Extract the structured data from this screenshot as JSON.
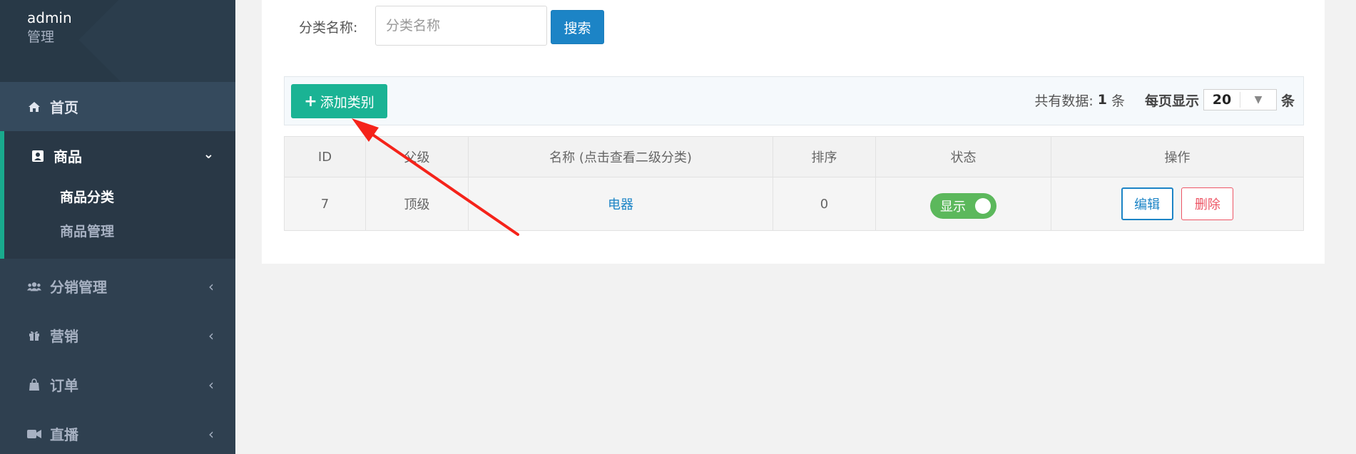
{
  "brand": {
    "user": "admin",
    "role": "管理"
  },
  "nav": {
    "home": "首页",
    "goods": {
      "label": "商品",
      "sub": [
        "商品分类",
        "商品管理"
      ]
    },
    "distribution": "分销管理",
    "marketing": "营销",
    "orders": "订单",
    "live": "直播"
  },
  "search": {
    "label": "分类名称:",
    "placeholder": "分类名称",
    "button": "搜索"
  },
  "toolbar": {
    "add_button": "添加类别",
    "total_prefix": "共有数据:",
    "total_count": "1",
    "total_unit": "条",
    "per_page_label": "每页显示",
    "per_page_value": "20",
    "per_page_unit": "条"
  },
  "table": {
    "headers": [
      "ID",
      "父级",
      "名称 (点击查看二级分类)",
      "排序",
      "状态",
      "操作"
    ],
    "rows": [
      {
        "id": "7",
        "parent": "顶级",
        "name": "电器",
        "sort": "0",
        "status": "显示",
        "edit": "编辑",
        "delete": "删除"
      }
    ]
  }
}
